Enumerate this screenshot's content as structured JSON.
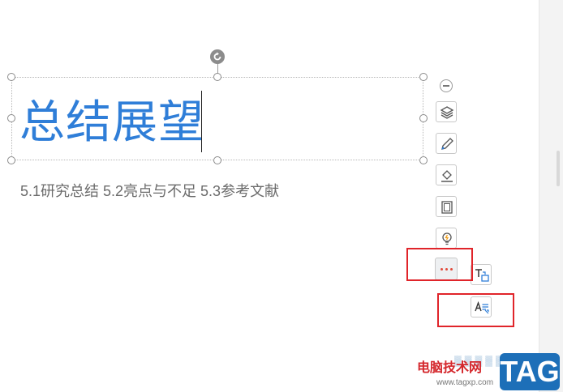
{
  "slide": {
    "title": "总结展望",
    "subtitle": "5.1研究总结   5.2亮点与不足   5.3参考文献"
  },
  "toolbar": {
    "items": [
      "collapse-icon",
      "layers-icon",
      "pen-icon",
      "fill-icon",
      "frame-icon",
      "lightbulb-icon",
      "more-icon"
    ],
    "submenu": [
      "text-box-icon",
      "text-style-icon"
    ],
    "accent_color": "#e24a3b",
    "highlight_color": "#e0242a"
  },
  "watermark": {
    "site_name": "电脑技术网",
    "url": "www.tagxp.com",
    "badge": "TAG"
  }
}
